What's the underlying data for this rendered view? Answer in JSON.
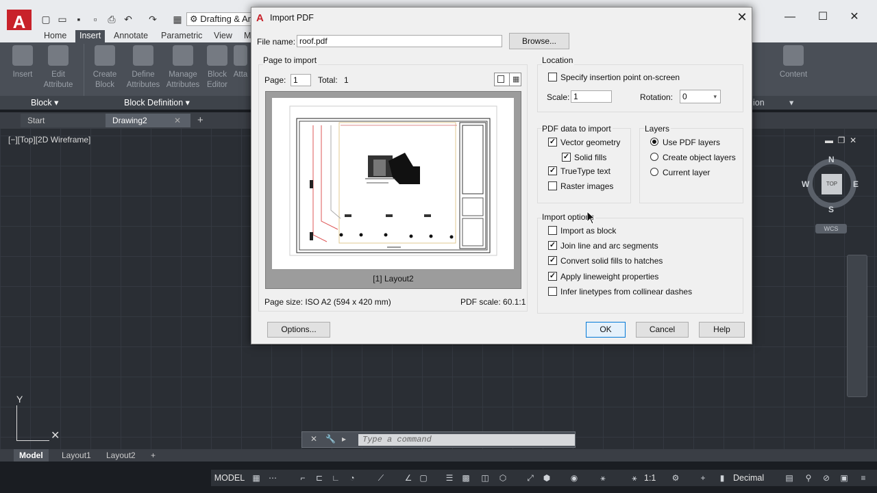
{
  "app": {
    "logo": "A",
    "workspace": "Drafting & Ar",
    "ribbon_tabs": [
      "Home",
      "Insert",
      "Annotate",
      "Parametric",
      "View",
      "M"
    ],
    "ribbon_buttons": [
      {
        "label": "Insert"
      },
      {
        "label": "Edit Attribute"
      },
      {
        "label": "Create Block"
      },
      {
        "label": "Define Attributes"
      },
      {
        "label": "Manage Attributes"
      },
      {
        "label": "Block Editor"
      },
      {
        "label": "Atta"
      },
      {
        "label": "Content"
      }
    ],
    "panel_titles": {
      "block": "Block",
      "block_definition": "Block Definition",
      "right": "ion"
    },
    "file_tabs": {
      "start": "Start",
      "drawing": "Drawing2"
    },
    "view_label": "[−][Top][2D Wireframe]",
    "viewcube": {
      "top": "TOP",
      "n": "N",
      "s": "S",
      "e": "E",
      "w": "W",
      "wcs": "WCS"
    },
    "ucs": {
      "y": "Y"
    },
    "command_placeholder": "Type a command",
    "layout_tabs": [
      "Model",
      "Layout1",
      "Layout2"
    ],
    "status": {
      "model": "MODEL",
      "scale": "1:1",
      "units": "Decimal"
    }
  },
  "dialog": {
    "title": "Import PDF",
    "file_name_label": "File name:",
    "file_name_value": "roof.pdf",
    "browse_label": "Browse...",
    "page_to_import": {
      "title": "Page to import",
      "page_label": "Page:",
      "page_value": "1",
      "total_label": "Total:",
      "total_value": "1",
      "preview_caption": "[1] Layout2",
      "page_size": "Page size:  ISO A2 (594 x 420 mm)",
      "pdf_scale": "PDF scale:  60.1:1"
    },
    "location": {
      "title": "Location",
      "specify_label": "Specify insertion point on-screen",
      "specify_checked": false,
      "scale_label": "Scale:",
      "scale_value": "1",
      "rotation_label": "Rotation:",
      "rotation_value": "0"
    },
    "pdf_data": {
      "title": "PDF data to import",
      "items": [
        {
          "label": "Vector geometry",
          "checked": true
        },
        {
          "label": "Solid fills",
          "checked": true
        },
        {
          "label": "TrueType text",
          "checked": true
        },
        {
          "label": "Raster images",
          "checked": false
        }
      ]
    },
    "layers": {
      "title": "Layers",
      "items": [
        {
          "label": "Use PDF layers",
          "selected": true
        },
        {
          "label": "Create object layers",
          "selected": false
        },
        {
          "label": "Current layer",
          "selected": false
        }
      ]
    },
    "import_options": {
      "title": "Import options",
      "items": [
        {
          "label": "Import as block",
          "checked": false
        },
        {
          "label": "Join line and arc segments",
          "checked": true
        },
        {
          "label": "Convert solid fills to hatches",
          "checked": true
        },
        {
          "label": "Apply lineweight properties",
          "checked": true
        },
        {
          "label": "Infer linetypes from collinear dashes",
          "checked": false
        }
      ]
    },
    "buttons": {
      "options": "Options...",
      "ok": "OK",
      "cancel": "Cancel",
      "help": "Help"
    }
  }
}
